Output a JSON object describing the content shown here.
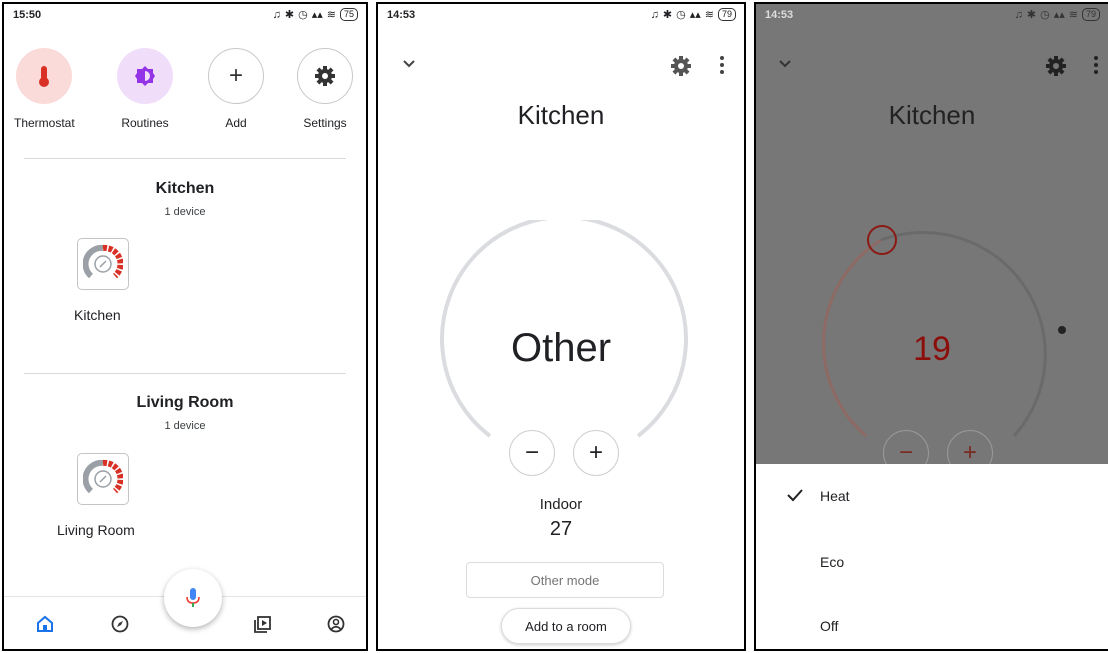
{
  "panel1": {
    "status": {
      "time": "15:50",
      "battery": "75"
    },
    "quick_actions": [
      {
        "label": "Thermostat",
        "icon": "thermometer-icon"
      },
      {
        "label": "Routines",
        "icon": "routines-icon"
      },
      {
        "label": "Add",
        "icon": "plus-icon"
      },
      {
        "label": "Settings",
        "icon": "gear-icon"
      }
    ],
    "rooms": [
      {
        "title": "Kitchen",
        "count": "1 device",
        "device": "Kitchen"
      },
      {
        "title": "Living Room",
        "count": "1 device",
        "device": "Living Room"
      }
    ],
    "nav": [
      "home-icon",
      "explore-icon",
      "media-icon",
      "account-icon"
    ]
  },
  "panel2": {
    "status": {
      "time": "14:53",
      "battery": "79"
    },
    "title": "Kitchen",
    "mode": "Other",
    "indoor_label": "Indoor",
    "indoor_value": "27",
    "mode_button": "Other mode",
    "add_room": "Add to a room"
  },
  "panel3": {
    "status": {
      "time": "14:53",
      "battery": "79"
    },
    "title": "Kitchen",
    "setpoint": "19",
    "options": [
      {
        "label": "Heat",
        "selected": true
      },
      {
        "label": "Eco",
        "selected": false
      },
      {
        "label": "Off",
        "selected": false
      }
    ]
  },
  "colors": {
    "thermo_bg": "#fbdada",
    "thermo_icon": "#d93025",
    "routine_bg": "#f0ddfa",
    "routine_icon": "#9334e6",
    "blue": "#1a73e8",
    "red": "#b3261e"
  }
}
